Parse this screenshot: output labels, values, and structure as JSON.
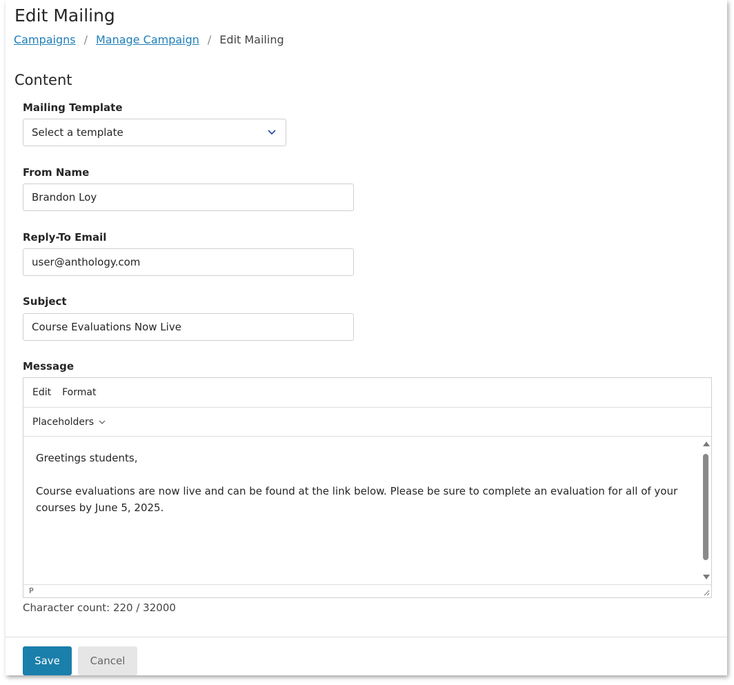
{
  "page": {
    "title": "Edit Mailing"
  },
  "breadcrumb": {
    "items": [
      "Campaigns",
      "Manage Campaign",
      "Edit Mailing"
    ],
    "separator": "/"
  },
  "content": {
    "section_title": "Content",
    "mailing_template": {
      "label": "Mailing Template",
      "placeholder": "Select a template"
    },
    "from_name": {
      "label": "From Name",
      "value": "Brandon Loy"
    },
    "reply_to": {
      "label": "Reply-To Email",
      "value": "user@anthology.com"
    },
    "subject": {
      "label": "Subject",
      "value": "Course Evaluations Now Live"
    },
    "message": {
      "label": "Message",
      "menu": [
        "Edit",
        "Format"
      ],
      "toolbar_placeholders": "Placeholders",
      "paragraphs": [
        "Greetings students,",
        "Course evaluations are now live and can be found at the link below.  Please be sure to complete an evaluation for all of your courses by June 5, 2025."
      ],
      "status_path": "P"
    },
    "char_count": "Character count: 220 / 32000"
  },
  "actions": {
    "save": "Save",
    "cancel": "Cancel"
  },
  "colors": {
    "link": "#1f7fb8",
    "primary_button": "#1a7faa",
    "secondary_button": "#e6e6e6"
  }
}
